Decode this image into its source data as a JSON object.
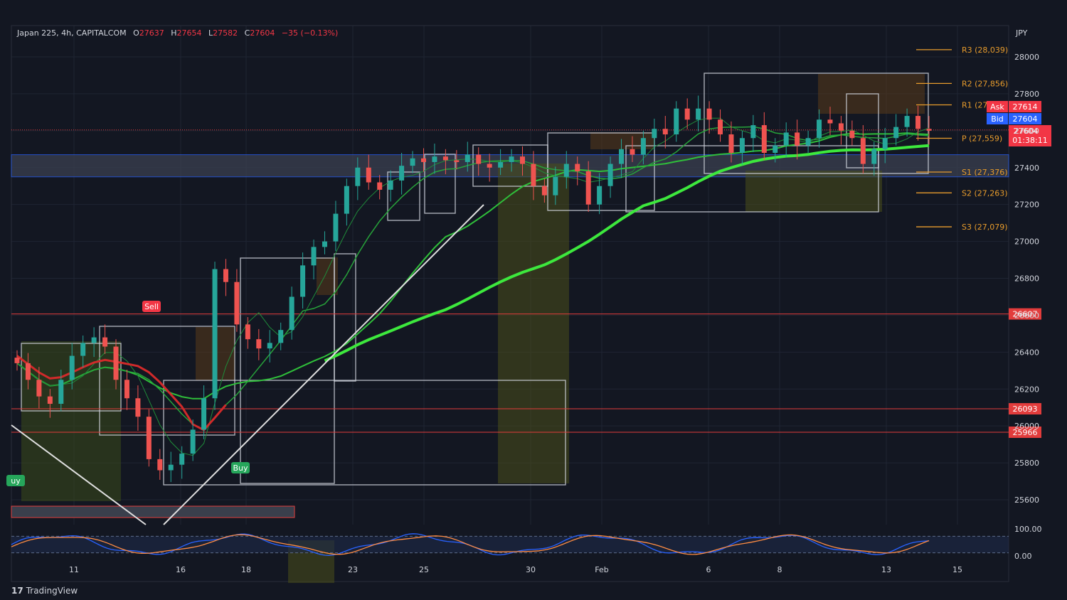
{
  "header": {
    "symbol": "Japan 225, 4h, CAPITALCOM",
    "open_label": "O",
    "open": "27637",
    "high_label": "H",
    "high": "27654",
    "low_label": "L",
    "low": "27582",
    "close_label": "C",
    "close": "27604",
    "change": "−35 (−0.13%)"
  },
  "footer": {
    "logo_glyph": "17",
    "brand": "TradingView"
  },
  "currency": "JPY",
  "colors": {
    "background": "#131722",
    "up": "#26a69a",
    "down": "#ef5350",
    "pivot": "#e89c2c",
    "level": "#e23c3c",
    "bid": "#2962ff",
    "zone_blue": "#2962ff",
    "ma_green": "#3de83d"
  },
  "chart_data": {
    "type": "candlestick",
    "symbol": "Japan 225",
    "interval": "4h",
    "ylim": [
      25500,
      28200
    ],
    "y_ticks": [
      28000,
      27800,
      27600,
      27400,
      27200,
      27000,
      26800,
      26600,
      26400,
      26200,
      26000,
      25800,
      25600
    ],
    "x_ticks": [
      "11",
      "16",
      "18",
      "23",
      "25",
      "30",
      "Feb",
      "6",
      "8",
      "13",
      "15"
    ],
    "pivots": [
      {
        "label": "R3 (28,039)",
        "value": 28039
      },
      {
        "label": "R2 (27,856)",
        "value": 27856
      },
      {
        "label": "R1 (27,",
        "value": 27740
      },
      {
        "label": "P (27,559)",
        "value": 27559
      },
      {
        "label": "S1 (27,376)",
        "value": 27376
      },
      {
        "label": "S2 (27,263)",
        "value": 27263
      },
      {
        "label": "S3 (27,079)",
        "value": 27079
      }
    ],
    "levels": [
      {
        "label": "26607",
        "value": 26607
      },
      {
        "label": "26093",
        "value": 26093
      },
      {
        "label": "25966",
        "value": 25966
      }
    ],
    "current_price": {
      "label": "27604",
      "countdown": "01:38:11",
      "value": 27604
    },
    "ask": {
      "label": "Ask",
      "value": "27614"
    },
    "bid": {
      "label": "Bid",
      "value": "27604"
    },
    "zone": {
      "low": 27350,
      "high": 27470
    },
    "signals": [
      {
        "label": "Sell",
        "x_index": 10
      },
      {
        "label": "Buy",
        "x_index": 17
      },
      {
        "label": "uy",
        "x_index": 0
      }
    ],
    "oscillator": {
      "ylim": [
        -10,
        110
      ],
      "ticks": [
        "100.00",
        "0.00"
      ],
      "bands": [
        85,
        15
      ]
    },
    "close_series": [
      26340,
      26250,
      26160,
      26120,
      26250,
      26380,
      26450,
      26480,
      26430,
      26250,
      26150,
      26050,
      25820,
      25760,
      25790,
      25850,
      25980,
      26150,
      26850,
      26780,
      26550,
      26470,
      26420,
      26450,
      26520,
      26700,
      26870,
      26970,
      27000,
      27150,
      27300,
      27400,
      27320,
      27280,
      27330,
      27410,
      27450,
      27430,
      27460,
      27440,
      27430,
      27470,
      27420,
      27400,
      27430,
      27460,
      27420,
      27300,
      27250,
      27350,
      27420,
      27380,
      27200,
      27300,
      27420,
      27500,
      27470,
      27560,
      27610,
      27580,
      27720,
      27660,
      27720,
      27660,
      27580,
      27480,
      27560,
      27630,
      27480,
      27520,
      27590,
      27520,
      27560,
      27660,
      27640,
      27600,
      27560,
      27420,
      27500,
      27560,
      27620,
      27680,
      27610,
      27600
    ]
  }
}
